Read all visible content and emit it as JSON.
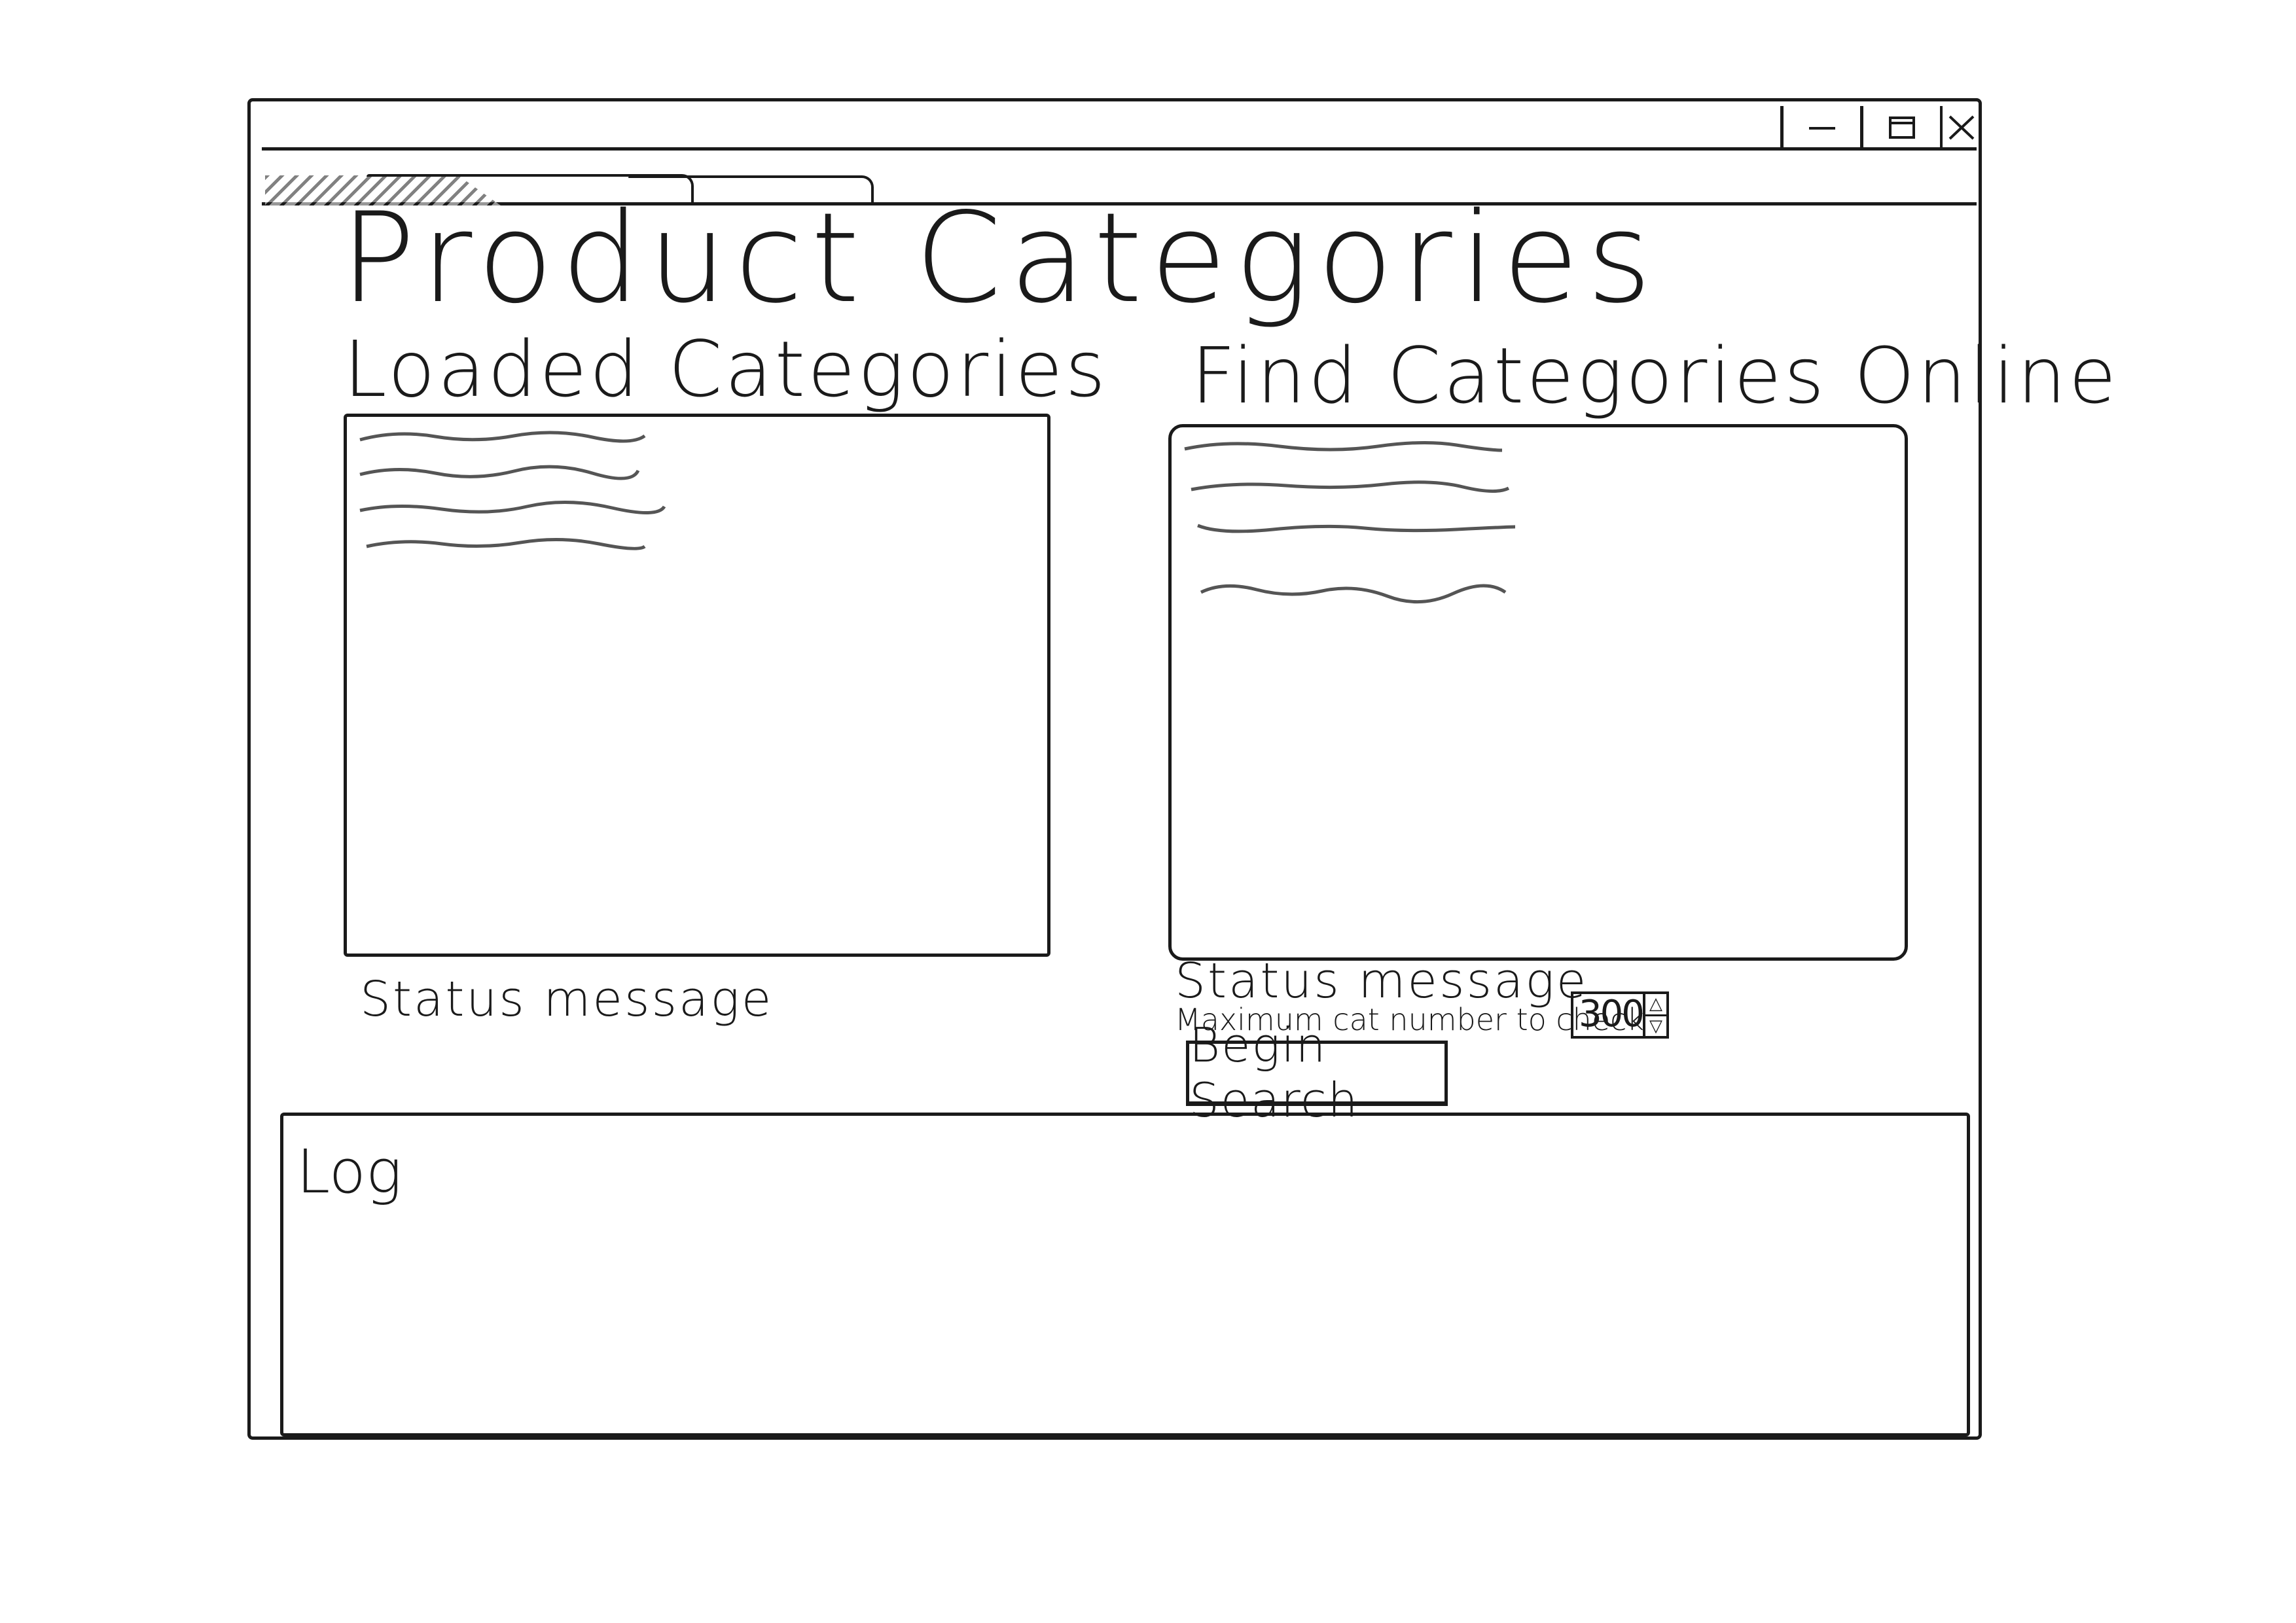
{
  "window": {
    "controls": [
      {
        "name": "minimize-icon"
      },
      {
        "name": "maximize-icon"
      },
      {
        "name": "close-icon"
      }
    ]
  },
  "tabs": [
    {
      "label": "",
      "state": "active"
    },
    {
      "label": "",
      "state": "inactive"
    }
  ],
  "page": {
    "title": "Product Categories"
  },
  "loaded_panel": {
    "heading": "Loaded Categories",
    "items": [
      "",
      "",
      "",
      ""
    ],
    "status": "Status message"
  },
  "online_panel": {
    "heading": "Find Categories Online",
    "items": [
      "",
      "",
      "",
      ""
    ],
    "status": "Status message",
    "max_label": "Maximum cat number to check",
    "max_value": "300",
    "button_label": "Begin Search"
  },
  "log": {
    "label": "Log"
  },
  "colors": {
    "ink": "#1a1a1a",
    "paper": "#ffffff"
  }
}
